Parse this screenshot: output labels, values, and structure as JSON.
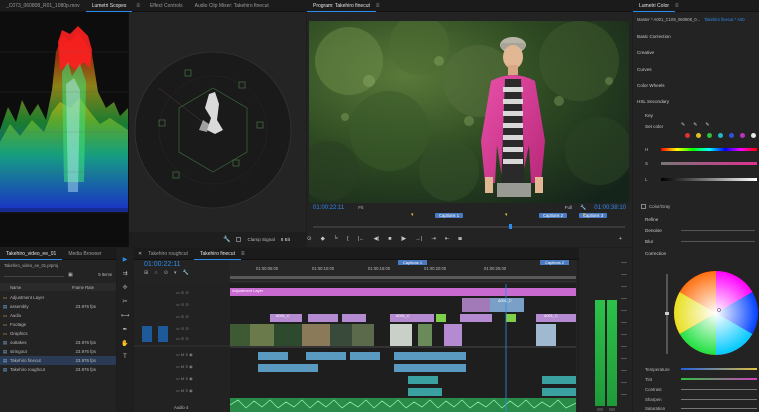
{
  "scopes_panel": {
    "tabs": [
      "_C073_060808_R01_1080p.mov",
      "Lumetri Scopes",
      "Effect Controls",
      "Audio Clip Mixer: Takehiro finecut"
    ],
    "active_tab": 1
  },
  "program_monitor": {
    "tab": "Program: Takehiro finecut",
    "timecode": "01:00:22:11",
    "fit": "Fit",
    "quality": "Full",
    "duration": "01:00:38:10",
    "captions": [
      "Captions 1",
      "Captions 2",
      "Captions 3"
    ]
  },
  "project_panel": {
    "tabs": [
      "Takehiro_video_ee_01",
      "Media Browser"
    ],
    "file": "Takehiro_video_ee_01.prproj",
    "count": "9 Items",
    "col_name": "Name",
    "col_rate": "Frame Rate",
    "items": [
      {
        "name": "Adjustment Layer",
        "rate": ""
      },
      {
        "name": "assembly",
        "rate": "23.976 fps"
      },
      {
        "name": "Audio",
        "rate": ""
      },
      {
        "name": "Footage",
        "rate": ""
      },
      {
        "name": "Graphics",
        "rate": ""
      },
      {
        "name": "outtakes",
        "rate": "23.976 fps"
      },
      {
        "name": "stringout",
        "rate": "23.976 fps"
      },
      {
        "name": "Takehiro finecut",
        "rate": "23.976 fps"
      },
      {
        "name": "Takehiro roughcut",
        "rate": "23.976 fps"
      }
    ]
  },
  "timeline": {
    "tabs": [
      "Takehiro roughcut",
      "Takehiro finecut"
    ],
    "active_tab": 1,
    "timecode": "01:00:22:11",
    "ruler": [
      "01:00:05:00",
      "01:00:10:00",
      "01:00:15:00",
      "01:00:20:00",
      "01:00:25:00"
    ],
    "captions": [
      "Captions 1",
      "Captions 2"
    ],
    "clamp_label": "Clamp Signal",
    "bit_label": "8 Bit",
    "adjustment_clip": "Adjustment Layer",
    "clip_prefix": "A001_C",
    "audio_track": "Audio 4"
  },
  "lumetri": {
    "tab": "Lumetri Color",
    "source": "Master * A001_C109_060808_0...",
    "sequence": "Takehiro finecut * A00",
    "sections": [
      "Basic Correction",
      "Creative",
      "Curves",
      "Color Wheels",
      "HSL Secondary"
    ],
    "key": "Key",
    "set_color": "Set color",
    "hsl": [
      "H",
      "S",
      "L"
    ],
    "color_gray": "Color/Gray",
    "refine": "Refine",
    "denoise": "Denoise",
    "blur": "Blur",
    "correction": "Correction",
    "sliders": [
      "Temperature",
      "Tint",
      "Contrast",
      "Sharpen",
      "Saturation"
    ],
    "accent": "#2d8ceb"
  }
}
